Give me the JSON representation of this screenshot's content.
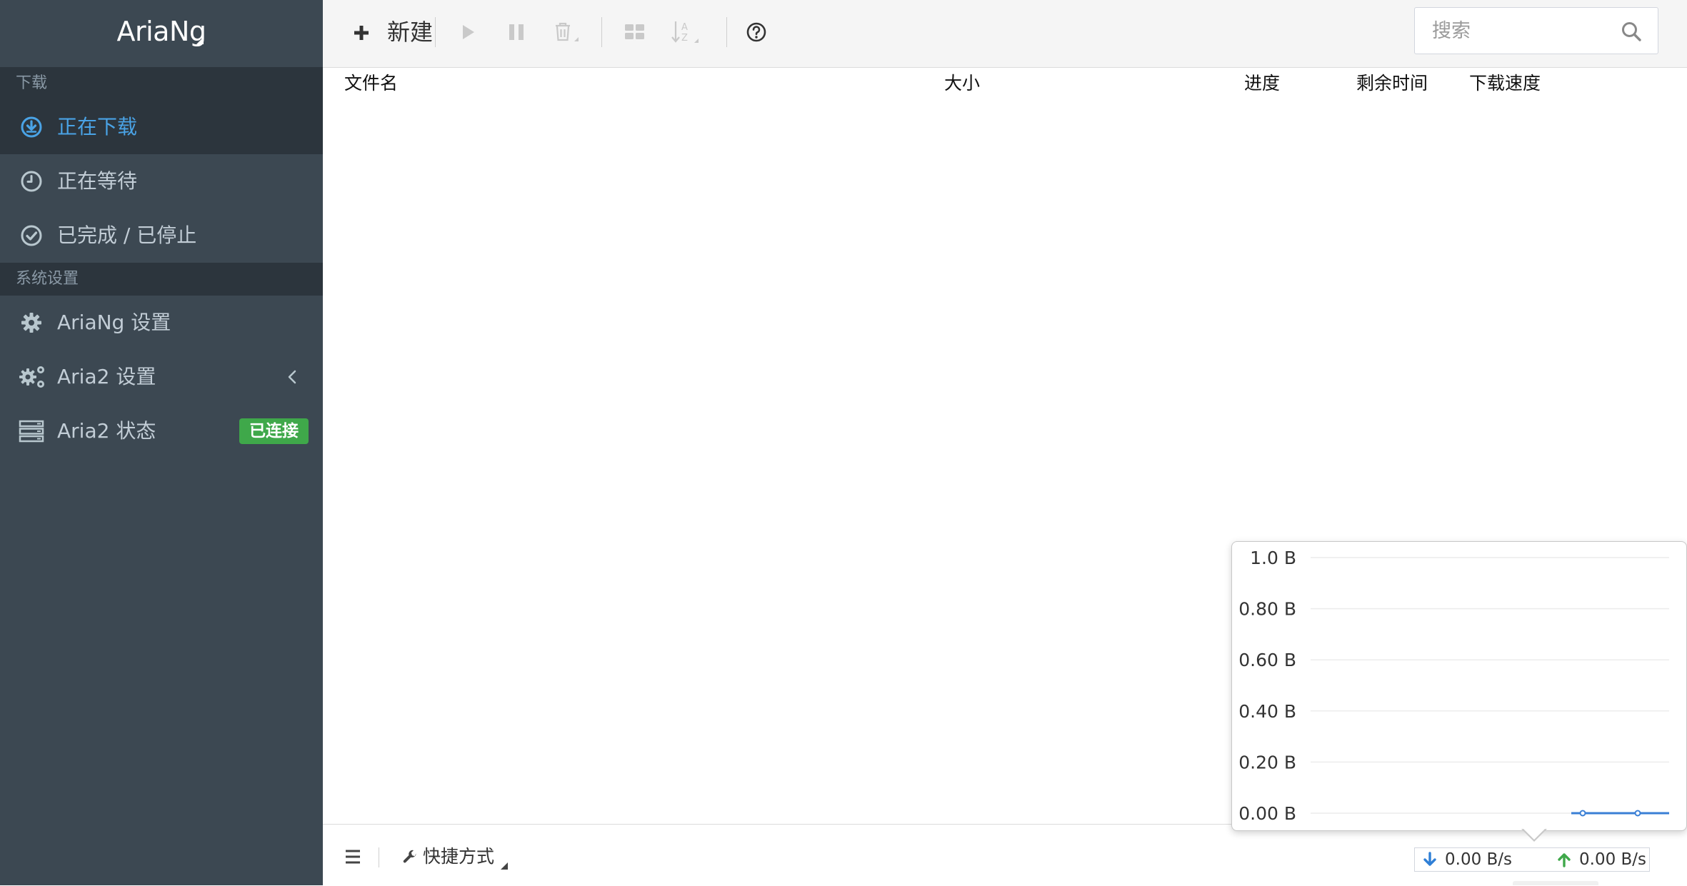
{
  "brand": {
    "name": "AriaNg"
  },
  "sidebar": {
    "download_section": "下载",
    "items": [
      {
        "label": "正在下载",
        "icon": "download-circle-icon",
        "active": true
      },
      {
        "label": "正在等待",
        "icon": "clock-icon",
        "active": false
      },
      {
        "label": "已完成 / 已停止",
        "icon": "check-circle-icon",
        "active": false
      }
    ],
    "settings_section": "系统设置",
    "settings_items": [
      {
        "label": "AriaNg 设置",
        "icon": "gear-icon"
      },
      {
        "label": "Aria2 设置",
        "icon": "gears-icon"
      },
      {
        "label": "Aria2 状态",
        "icon": "server-icon",
        "badge": "已连接"
      }
    ]
  },
  "toolbar": {
    "new_label": "新建",
    "search": {
      "placeholder": "搜索",
      "value": ""
    }
  },
  "table": {
    "columns": [
      "文件名",
      "大小",
      "进度",
      "剩余时间",
      "下载速度"
    ],
    "rows": []
  },
  "footer": {
    "shortcut_label": "快捷方式",
    "download_speed": "0.00 B/s",
    "upload_speed": "0.00 B/s"
  },
  "chart_data": {
    "type": "line",
    "title": "",
    "xlabel": "",
    "ylabel": "",
    "y_tick_labels": [
      "1.0 B",
      "0.80 B",
      "0.60 B",
      "0.40 B",
      "0.20 B",
      "0.00 B"
    ],
    "ylim": [
      0,
      1
    ],
    "grid": true,
    "series": [
      {
        "color": "#3a7fd5",
        "values": [
          0,
          0
        ]
      }
    ]
  },
  "colors": {
    "sidebar_bg": "#3c4852",
    "active_text": "#4aa3e6",
    "badge_green": "#3fa84a",
    "download_arrow": "#2f7fd6",
    "upload_arrow": "#3fa84a"
  }
}
